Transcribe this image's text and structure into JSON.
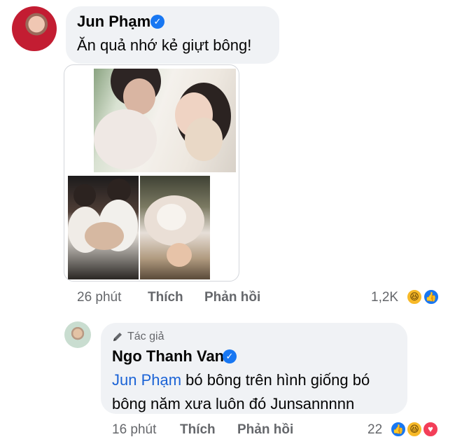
{
  "comment": {
    "author": "Jun Phạm",
    "text": "Ăn quả nhớ kẻ giựt bông!",
    "time": "26 phút",
    "like_label": "Thích",
    "reply_label": "Phản hồi",
    "reaction_count": "1,2K",
    "reactions": [
      "haha-icon",
      "like-icon"
    ]
  },
  "reply": {
    "badge": "Tác giả",
    "author": "Ngo Thanh Van",
    "mention": "Jun Phạm",
    "text_line1_rest": " bó bông trên hình giống bó",
    "text_line2": "bông năm xưa luôn đó Junsannnnn",
    "time": "16 phút",
    "like_label": "Thích",
    "reply_label": "Phản hồi",
    "reaction_count": "22",
    "reactions": [
      "like-icon",
      "haha-icon",
      "love-icon"
    ]
  },
  "colors": {
    "bubble": "#f0f2f5",
    "text": "#050505",
    "meta": "#65676b",
    "mention": "#1b63d6",
    "verified": "#1877f2"
  }
}
